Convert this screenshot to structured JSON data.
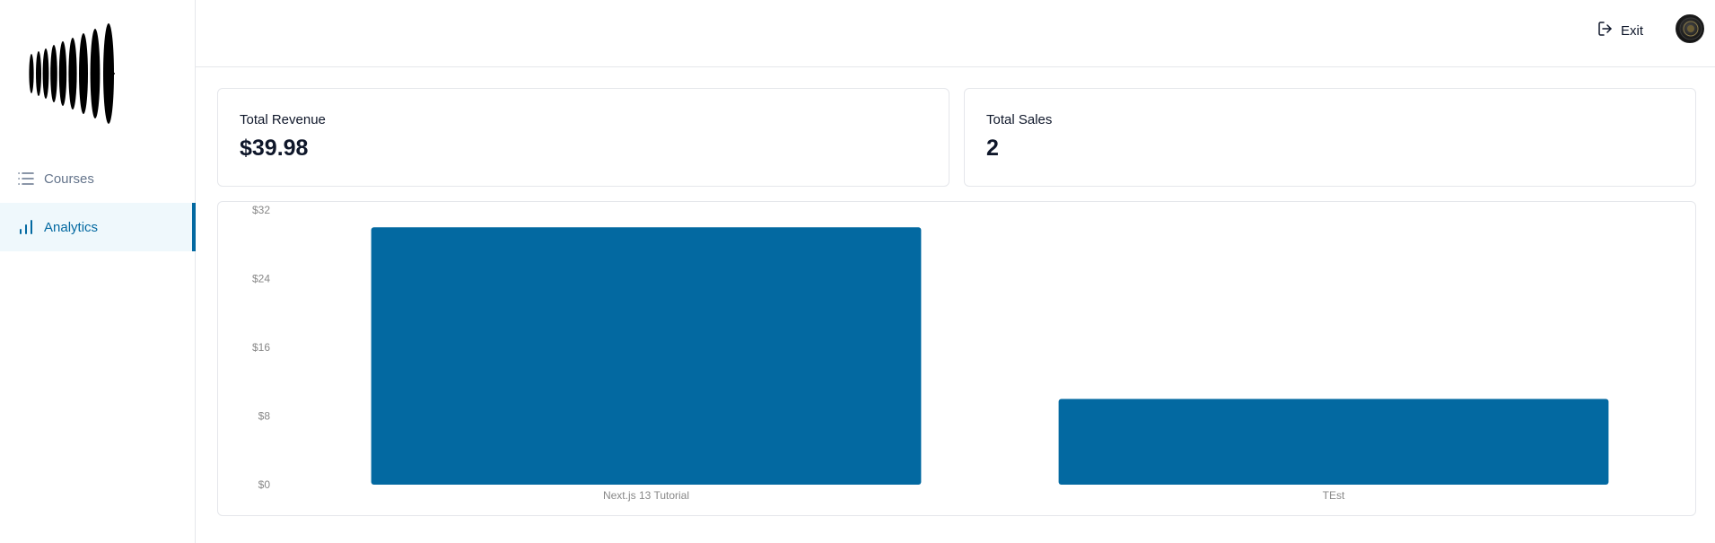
{
  "sidebar": {
    "logo": "logo",
    "items": [
      {
        "label": "Courses",
        "icon": "list-icon",
        "active": false
      },
      {
        "label": "Analytics",
        "icon": "bar-chart-icon",
        "active": true
      }
    ]
  },
  "header": {
    "exit_label": "Exit",
    "exit_icon": "log-out-icon",
    "avatar": "user-avatar"
  },
  "stats": {
    "revenue": {
      "label": "Total Revenue",
      "value": "$39.98"
    },
    "sales": {
      "label": "Total Sales",
      "value": "2"
    }
  },
  "colors": {
    "accent": "#0369a1",
    "bar": "#0369a1",
    "active_bg": "#eff8fc",
    "muted_text": "#64748b",
    "border": "#e5e7eb"
  },
  "chart_data": {
    "type": "bar",
    "categories": [
      "Next.js 13 Tutorial",
      "TEst"
    ],
    "values": [
      29.99,
      9.99
    ],
    "ylim": [
      0,
      32
    ],
    "yticks": [
      0,
      8,
      16,
      24,
      32
    ],
    "ytick_labels": [
      "$0",
      "$8",
      "$16",
      "$24",
      "$32"
    ],
    "grid": false,
    "legend": "none"
  }
}
